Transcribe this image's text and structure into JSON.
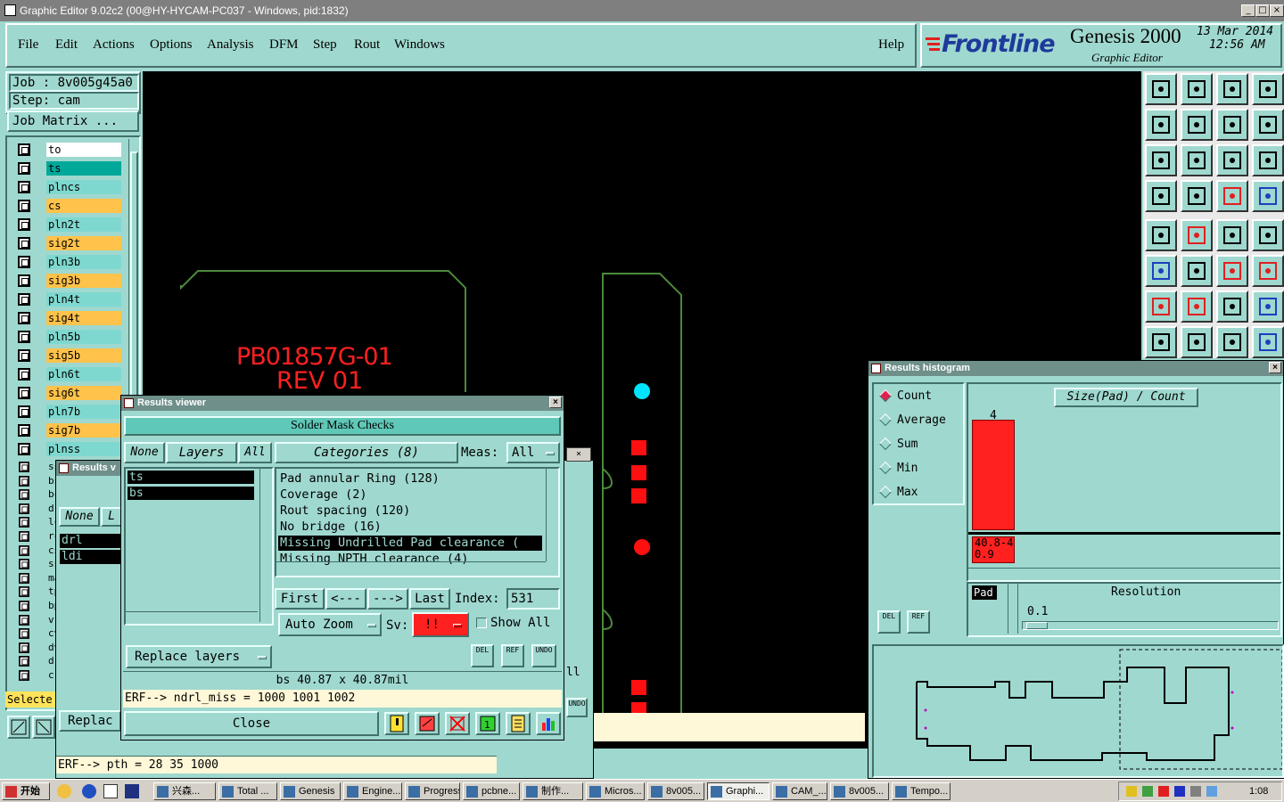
{
  "app": {
    "title": "Graphic Editor 9.02c2 (00@HY-HYCAM-PC037 - Windows, pid:1832)",
    "window_buttons": [
      "_",
      "□",
      "×"
    ]
  },
  "menu": {
    "items": [
      "File",
      "Edit",
      "Actions",
      "Options",
      "Analysis",
      "DFM",
      "Step",
      "Rout",
      "Windows"
    ],
    "help": "Help"
  },
  "brand": {
    "logo": "Frontline",
    "product": "Genesis 2000",
    "subtitle": "Graphic Editor",
    "date": "13 Mar 2014",
    "time": "12:56 AM",
    "logo_color": "#1e3a9a",
    "logo_accent": "#e02020"
  },
  "job": {
    "job_line": "Job : 8v005g45a0",
    "step_line": "Step: cam",
    "matrix_button": "Job Matrix ..."
  },
  "layers": [
    {
      "name": "to",
      "color": "#ffffff"
    },
    {
      "name": "ts",
      "color": "#00a89a"
    },
    {
      "name": "plncs",
      "color": "#7fd8cf"
    },
    {
      "name": "cs",
      "color": "#ffc24a"
    },
    {
      "name": "pln2t",
      "color": "#7fd8cf"
    },
    {
      "name": "sig2t",
      "color": "#ffc24a"
    },
    {
      "name": "pln3b",
      "color": "#7fd8cf"
    },
    {
      "name": "sig3b",
      "color": "#ffc24a"
    },
    {
      "name": "pln4t",
      "color": "#7fd8cf"
    },
    {
      "name": "sig4t",
      "color": "#ffc24a"
    },
    {
      "name": "pln5b",
      "color": "#7fd8cf"
    },
    {
      "name": "sig5b",
      "color": "#ffc24a"
    },
    {
      "name": "pln6t",
      "color": "#7fd8cf"
    },
    {
      "name": "sig6t",
      "color": "#ffc24a"
    },
    {
      "name": "pln7b",
      "color": "#7fd8cf"
    },
    {
      "name": "sig7b",
      "color": "#ffc24a"
    },
    {
      "name": "plnss",
      "color": "#7fd8cf"
    }
  ],
  "layers_lower": [
    "ss",
    "bs",
    "bc",
    "dr",
    "lc",
    "rc",
    "cs",
    "ss",
    "ma",
    "tp",
    "bp",
    "v-",
    "cv",
    "dv",
    "d",
    "c"
  ],
  "selected_label": "Selecte",
  "board_text": {
    "line1": "PB01857G-01",
    "line2": "REV 01",
    "color": "#ff2020"
  },
  "results_viewer": {
    "title": "Results viewer",
    "header": "Solder Mask Checks",
    "none_btn": "None",
    "layers_btn": "Layers",
    "all_btn": "All",
    "layers_list": [
      "ts",
      "bs"
    ],
    "categories_btn": "Categories (8)",
    "meas_label": "Meas:",
    "meas_value": "All",
    "categories": [
      "Pad annular Ring (128)",
      "Coverage (2)",
      "Rout spacing (120)",
      "No bridge (16)",
      "Missing Undrilled Pad clearance (",
      "Missing NPTH clearance (4)"
    ],
    "selected_category": 4,
    "nav": {
      "first": "First",
      "prev": "<---",
      "next": "--->",
      "last": "Last",
      "index_label": "Index:",
      "index_value": "531"
    },
    "auto_zoom": "Auto Zoom",
    "sv_label": "Sv:",
    "sv_value": "!!",
    "show_all": "Show All",
    "replace_layers": "Replace layers",
    "del": "DEL",
    "ref": "REF",
    "undo": "UNDO",
    "measure": "bs 40.87 x 40.87mil",
    "erf": "ERF--> ndrl_miss = 1000 1001 1002",
    "close": "Close"
  },
  "results_viewer_back": {
    "title": "Results v",
    "none_btn": "None",
    "l_btn": "L",
    "layers_list": [
      "drl",
      "ldi"
    ],
    "replace": "Replac",
    "erf": "ERF--> pth = 28 35 1000",
    "fragment": "ll",
    "undo": "UNDO"
  },
  "histogram": {
    "title": "Results histogram",
    "modes": [
      "Count",
      "Average",
      "Sum",
      "Min",
      "Max"
    ],
    "selected_mode": "Count",
    "chart_title": "Size(Pad) / Count",
    "bar_value": "4",
    "bar_count": 4,
    "bar_range": "40.8-40.9",
    "bar_color": "#ff2020",
    "pad_label": "Pad",
    "resolution_label": "Resolution",
    "resolution_value": "0.1",
    "del": "DEL",
    "ref": "REF"
  },
  "toolbox": {
    "group1": [
      "open-icon",
      "save-icon",
      "home-icon",
      "window-icon",
      "import-icon",
      "export-icon",
      "rotate-icon",
      "flip-icon",
      "zoom-fit-icon",
      "pan-icon",
      "scale-icon",
      "help-icon",
      "tools-icon",
      "grid-icon",
      "layer-red-icon",
      "layer-blue-icon"
    ],
    "group2": [
      "pad-icon",
      "shape-icon",
      "ruler-icon",
      "dot-icon",
      "connect-icon",
      "cross-icon",
      "node-icon",
      "node2-icon",
      "angle-icon",
      "line-icon",
      "arc-icon",
      "font-icon",
      "snap-icon",
      "measure-icon",
      "distance-icon",
      "group-icon"
    ]
  },
  "taskbar": {
    "start": "开始",
    "items": [
      "兴森...",
      "Total ...",
      "Genesis",
      "Engine...",
      "Progress",
      "pcbne...",
      "制作...",
      "Micros...",
      "8v005...",
      "Graphi...",
      "CAM_...",
      "8v005...",
      "Tempo..."
    ],
    "clock": "1:08"
  }
}
